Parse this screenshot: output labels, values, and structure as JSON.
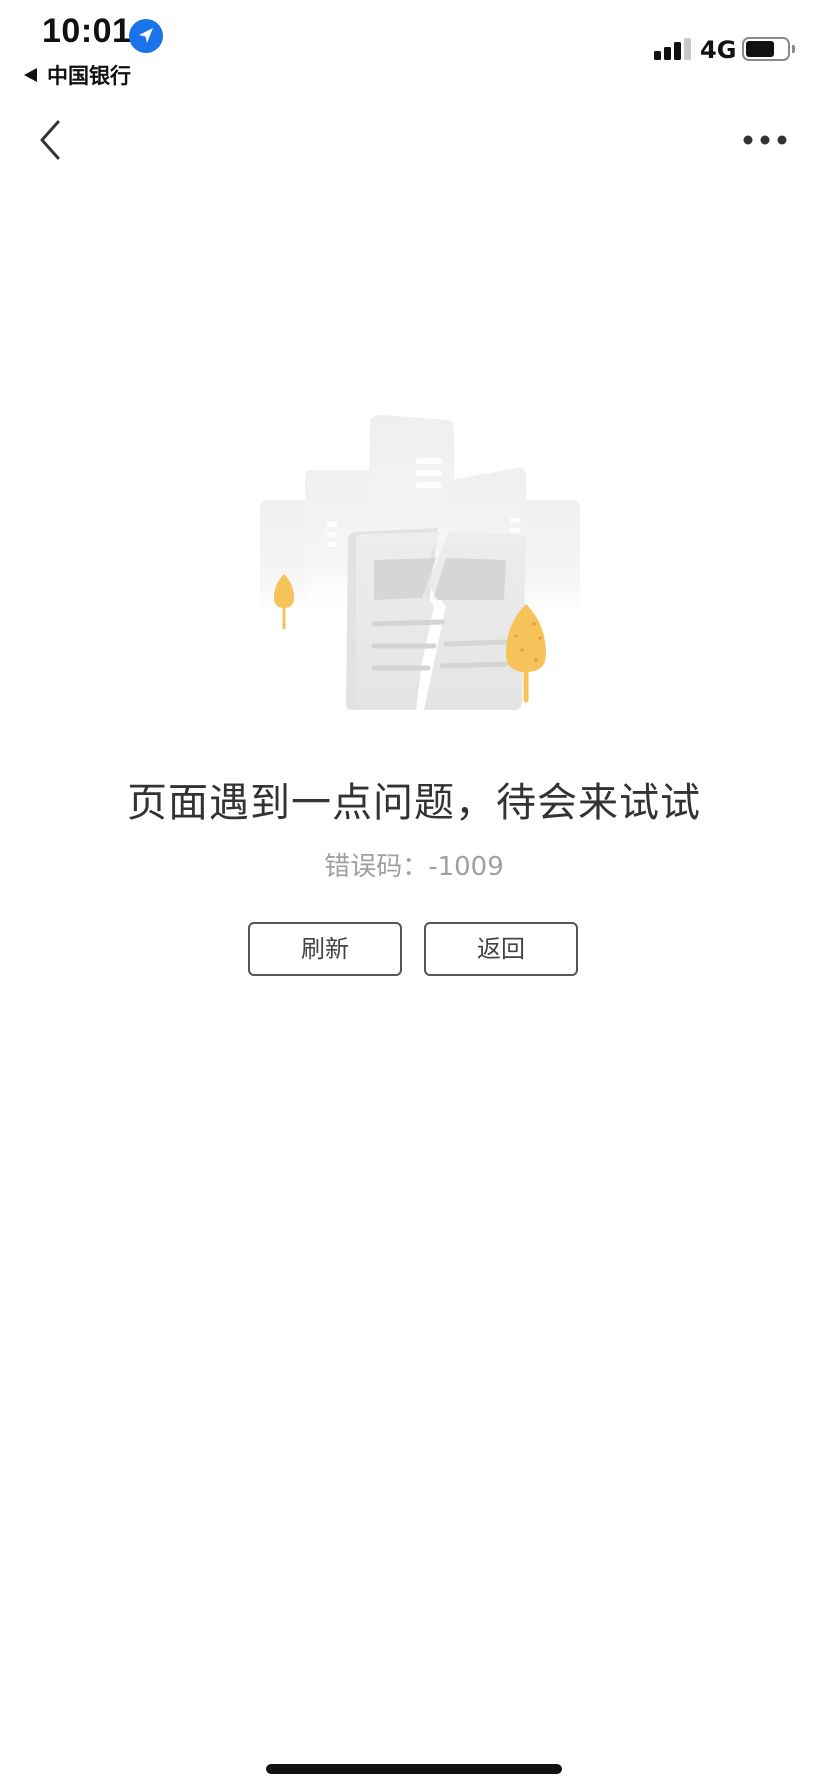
{
  "status_bar": {
    "time": "10:01",
    "back_app_label": "中国银行",
    "network": "4G",
    "battery_level": 0.7,
    "signal_bars": 3
  },
  "nav": {
    "back_icon": "chevron-left-icon",
    "more_icon": "more-horizontal-icon"
  },
  "error": {
    "title": "页面遇到一点问题，待会来试试",
    "code_label": "错误码：",
    "code_value": "-1009"
  },
  "actions": {
    "refresh_label": "刷新",
    "back_label": "返回"
  },
  "colors": {
    "accent_location": "#1a73e8",
    "tree_yellow": "#f6c25a",
    "button_border": "#555555",
    "muted_text": "#a0a0a0"
  }
}
